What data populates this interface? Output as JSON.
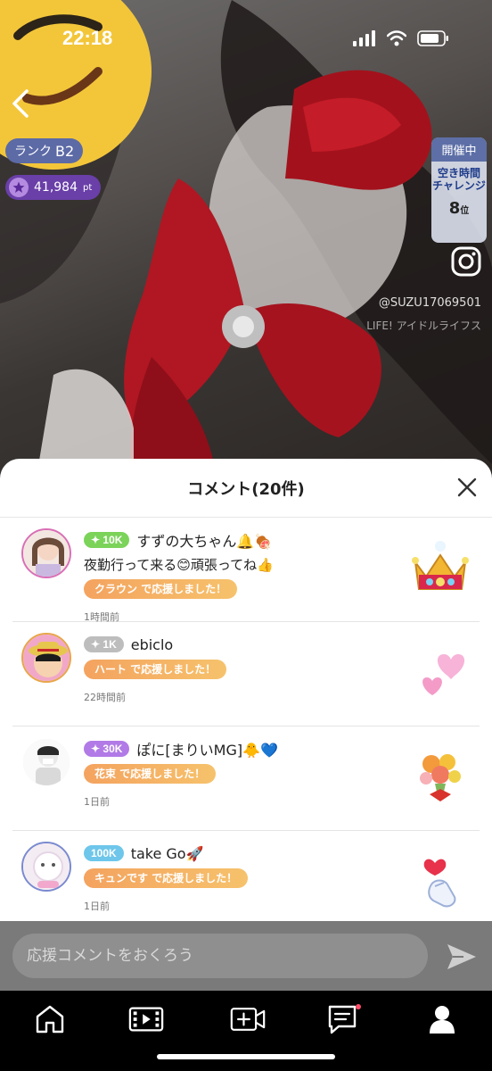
{
  "status_bar": {
    "time": "22:18"
  },
  "profile": {
    "rank_label": "ランク",
    "rank_value": "B2",
    "points": "41,984",
    "points_unit": "pt"
  },
  "event": {
    "status": "開催中",
    "title_line1": "空き時間",
    "title_line2": "チャレンジ",
    "rank": "8",
    "rank_unit": "位"
  },
  "overlay": {
    "handle": "@SUZU17069501",
    "app_tag": "LIFE! アイドルライフス"
  },
  "sheet": {
    "title": "コメント(20件)"
  },
  "comments": [
    {
      "tier": "✦ 10K",
      "tier_color": "#7bd35a",
      "name": "すずの大ちゃん🔔🍖",
      "message": "夜勤行って来る😊頑張ってね👍",
      "support": "クラウン で応援しました！",
      "ago": "1時間前",
      "gift": "crown"
    },
    {
      "tier": "✦ 1K",
      "tier_color": "#bdbdbd",
      "name": "ebiclo",
      "message": "",
      "support": "ハート で応援しました！",
      "ago": "22時間前",
      "gift": "hearts"
    },
    {
      "tier": "✦ 30K",
      "tier_color": "#b17ae6",
      "name": "ぽに[まりいMG]🐥💙",
      "message": "",
      "support": "花束 で応援しました！",
      "ago": "1日前",
      "gift": "bouquet"
    },
    {
      "tier": "100K",
      "tier_color": "#6ec6ea",
      "name": "take Go🚀",
      "message": "",
      "support": "キュンです で応援しました！",
      "ago": "1日前",
      "gift": "finger-heart"
    }
  ],
  "input": {
    "placeholder": "応援コメントをおくろう"
  }
}
